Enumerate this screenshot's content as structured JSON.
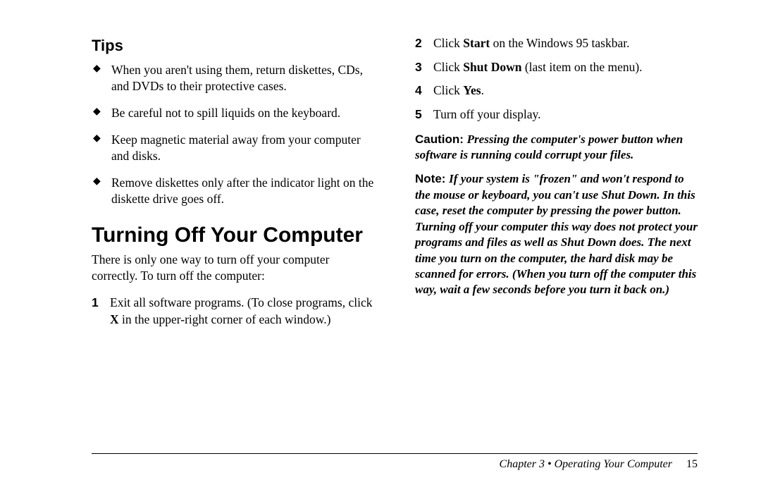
{
  "left": {
    "tips_heading": "Tips",
    "tips": [
      "When you aren't using them, return diskettes, CDs, and DVDs to their protective cases.",
      "Be careful not to spill liquids on the keyboard.",
      "Keep magnetic material away from your computer and disks.",
      "Remove diskettes only after the indicator light on the diskette drive goes off."
    ],
    "section_heading": "Turning Off Your Computer",
    "intro": "There is only one way to turn off your computer correctly. To turn off the computer:",
    "step1_num": "1",
    "step1_a": "Exit all software programs. (To close programs, click ",
    "step1_bold": "X",
    "step1_b": " in the upper-right corner of each window.)"
  },
  "right": {
    "step2_num": "2",
    "step2_a": "Click ",
    "step2_bold": "Start",
    "step2_b": " on the Windows 95 taskbar.",
    "step3_num": "3",
    "step3_a": "Click ",
    "step3_bold": "Shut Down",
    "step3_b": " (last item on the menu).",
    "step4_num": "4",
    "step4_a": "Click ",
    "step4_bold": "Yes",
    "step4_b": ".",
    "step5_num": "5",
    "step5_txt": "Turn off your display.",
    "caution_label": "Caution: ",
    "caution_body": "Pressing the computer's power button when software is running could corrupt your files.",
    "note_label": "Note: ",
    "note_body": "If your system is \"frozen\" and won't respond to the mouse or keyboard, you can't use Shut Down. In this case, reset the computer by pressing the power button. Turning off your computer this way does not protect your programs and files as well as Shut Down does. The next time you turn on the computer, the hard disk may be scanned for errors. (When you turn off the computer this way, wait a few seconds before you turn it back on.)"
  },
  "footer": {
    "chapter": "Chapter 3  •  Operating Your Computer",
    "page": "15"
  }
}
